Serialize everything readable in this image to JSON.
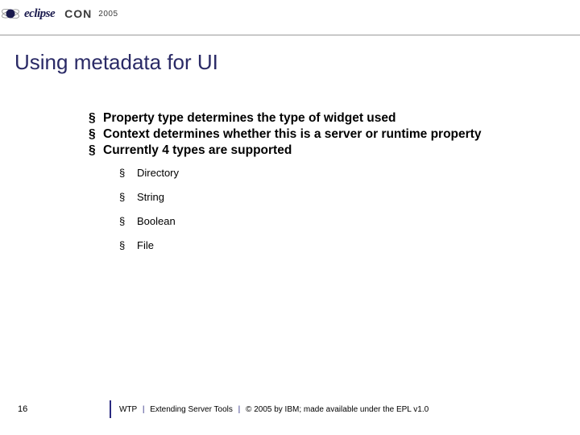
{
  "header": {
    "eclipse": "eclipse",
    "con": "CON",
    "year": "2005"
  },
  "title": "Using metadata for UI",
  "bullets": {
    "main": [
      "Property type determines the type of widget used",
      "Context determines whether this is a server or runtime property",
      "Currently 4 types are supported"
    ],
    "sub": [
      "Directory",
      "String",
      "Boolean",
      "File"
    ]
  },
  "footer": {
    "page": "16",
    "project": "WTP",
    "session": "Extending Server Tools",
    "copyright": "© 2005 by IBM; made available under the EPL v1.0"
  }
}
